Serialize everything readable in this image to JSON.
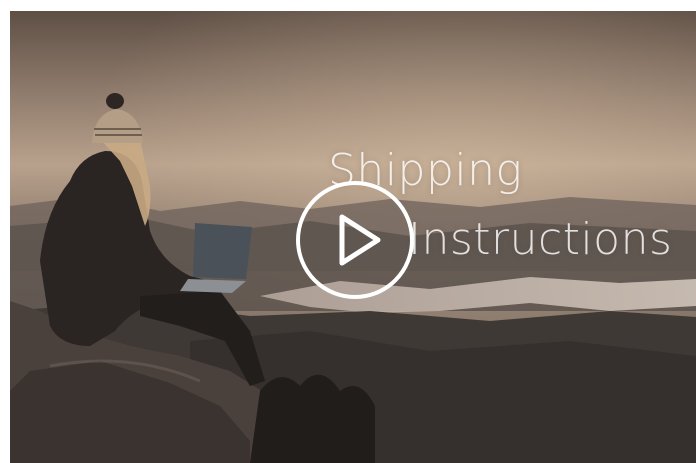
{
  "video": {
    "title_line_1": "Shipping",
    "title_line_2": "Instructions",
    "play_icon": "play-icon",
    "accent_color": "#ffffff"
  }
}
